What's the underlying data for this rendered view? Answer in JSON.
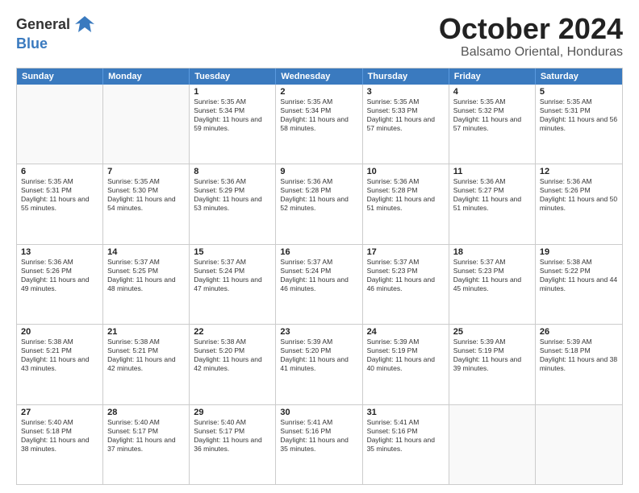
{
  "logo": {
    "general": "General",
    "blue": "Blue"
  },
  "title": "October 2024",
  "subtitle": "Balsamo Oriental, Honduras",
  "days": [
    "Sunday",
    "Monday",
    "Tuesday",
    "Wednesday",
    "Thursday",
    "Friday",
    "Saturday"
  ],
  "weeks": [
    [
      {
        "day": "",
        "info": ""
      },
      {
        "day": "",
        "info": ""
      },
      {
        "day": "1",
        "info": "Sunrise: 5:35 AM\nSunset: 5:34 PM\nDaylight: 11 hours and 59 minutes."
      },
      {
        "day": "2",
        "info": "Sunrise: 5:35 AM\nSunset: 5:34 PM\nDaylight: 11 hours and 58 minutes."
      },
      {
        "day": "3",
        "info": "Sunrise: 5:35 AM\nSunset: 5:33 PM\nDaylight: 11 hours and 57 minutes."
      },
      {
        "day": "4",
        "info": "Sunrise: 5:35 AM\nSunset: 5:32 PM\nDaylight: 11 hours and 57 minutes."
      },
      {
        "day": "5",
        "info": "Sunrise: 5:35 AM\nSunset: 5:31 PM\nDaylight: 11 hours and 56 minutes."
      }
    ],
    [
      {
        "day": "6",
        "info": "Sunrise: 5:35 AM\nSunset: 5:31 PM\nDaylight: 11 hours and 55 minutes."
      },
      {
        "day": "7",
        "info": "Sunrise: 5:35 AM\nSunset: 5:30 PM\nDaylight: 11 hours and 54 minutes."
      },
      {
        "day": "8",
        "info": "Sunrise: 5:36 AM\nSunset: 5:29 PM\nDaylight: 11 hours and 53 minutes."
      },
      {
        "day": "9",
        "info": "Sunrise: 5:36 AM\nSunset: 5:28 PM\nDaylight: 11 hours and 52 minutes."
      },
      {
        "day": "10",
        "info": "Sunrise: 5:36 AM\nSunset: 5:28 PM\nDaylight: 11 hours and 51 minutes."
      },
      {
        "day": "11",
        "info": "Sunrise: 5:36 AM\nSunset: 5:27 PM\nDaylight: 11 hours and 51 minutes."
      },
      {
        "day": "12",
        "info": "Sunrise: 5:36 AM\nSunset: 5:26 PM\nDaylight: 11 hours and 50 minutes."
      }
    ],
    [
      {
        "day": "13",
        "info": "Sunrise: 5:36 AM\nSunset: 5:26 PM\nDaylight: 11 hours and 49 minutes."
      },
      {
        "day": "14",
        "info": "Sunrise: 5:37 AM\nSunset: 5:25 PM\nDaylight: 11 hours and 48 minutes."
      },
      {
        "day": "15",
        "info": "Sunrise: 5:37 AM\nSunset: 5:24 PM\nDaylight: 11 hours and 47 minutes."
      },
      {
        "day": "16",
        "info": "Sunrise: 5:37 AM\nSunset: 5:24 PM\nDaylight: 11 hours and 46 minutes."
      },
      {
        "day": "17",
        "info": "Sunrise: 5:37 AM\nSunset: 5:23 PM\nDaylight: 11 hours and 46 minutes."
      },
      {
        "day": "18",
        "info": "Sunrise: 5:37 AM\nSunset: 5:23 PM\nDaylight: 11 hours and 45 minutes."
      },
      {
        "day": "19",
        "info": "Sunrise: 5:38 AM\nSunset: 5:22 PM\nDaylight: 11 hours and 44 minutes."
      }
    ],
    [
      {
        "day": "20",
        "info": "Sunrise: 5:38 AM\nSunset: 5:21 PM\nDaylight: 11 hours and 43 minutes."
      },
      {
        "day": "21",
        "info": "Sunrise: 5:38 AM\nSunset: 5:21 PM\nDaylight: 11 hours and 42 minutes."
      },
      {
        "day": "22",
        "info": "Sunrise: 5:38 AM\nSunset: 5:20 PM\nDaylight: 11 hours and 42 minutes."
      },
      {
        "day": "23",
        "info": "Sunrise: 5:39 AM\nSunset: 5:20 PM\nDaylight: 11 hours and 41 minutes."
      },
      {
        "day": "24",
        "info": "Sunrise: 5:39 AM\nSunset: 5:19 PM\nDaylight: 11 hours and 40 minutes."
      },
      {
        "day": "25",
        "info": "Sunrise: 5:39 AM\nSunset: 5:19 PM\nDaylight: 11 hours and 39 minutes."
      },
      {
        "day": "26",
        "info": "Sunrise: 5:39 AM\nSunset: 5:18 PM\nDaylight: 11 hours and 38 minutes."
      }
    ],
    [
      {
        "day": "27",
        "info": "Sunrise: 5:40 AM\nSunset: 5:18 PM\nDaylight: 11 hours and 38 minutes."
      },
      {
        "day": "28",
        "info": "Sunrise: 5:40 AM\nSunset: 5:17 PM\nDaylight: 11 hours and 37 minutes."
      },
      {
        "day": "29",
        "info": "Sunrise: 5:40 AM\nSunset: 5:17 PM\nDaylight: 11 hours and 36 minutes."
      },
      {
        "day": "30",
        "info": "Sunrise: 5:41 AM\nSunset: 5:16 PM\nDaylight: 11 hours and 35 minutes."
      },
      {
        "day": "31",
        "info": "Sunrise: 5:41 AM\nSunset: 5:16 PM\nDaylight: 11 hours and 35 minutes."
      },
      {
        "day": "",
        "info": ""
      },
      {
        "day": "",
        "info": ""
      }
    ]
  ]
}
